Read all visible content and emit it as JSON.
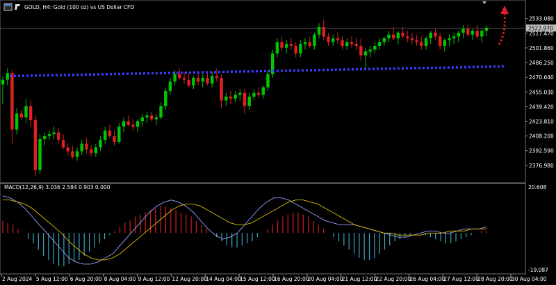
{
  "header": {
    "symbol_info": "GOLD, H4:  Gold (100 oz) vs US Dollar CFD",
    "icon": "window-icon"
  },
  "colors": {
    "background": "#000000",
    "bull": "#00c800",
    "bear": "#e02020",
    "support_line": "#3b3bff",
    "arrow": "#e0202a",
    "macd_hist_pos": "#d02020",
    "macd_hist_neg": "#3aa8c8",
    "macd_line": "#9aa0ff",
    "signal_line": "#e0c000",
    "grid": "#707070"
  },
  "price_axis": {
    "labels": [
      "2533.080",
      "2517.470",
      "2501.860",
      "2486.250",
      "2470.640",
      "2455.030",
      "2439.420",
      "2423.810",
      "2408.200",
      "2392.590",
      "2376.980"
    ],
    "current_price": "2522.970"
  },
  "macd_panel": {
    "label": "MACD(12,26,9) 3.036 2.584 0.903 0.000",
    "axis_top": "20.608",
    "axis_bottom": "-19.087"
  },
  "time_axis": {
    "labels": [
      "2 Aug 2024",
      "5 Aug 12:00",
      "6 Aug 20:00",
      "8 Aug 04:00",
      "9 Aug 12:00",
      "12 Aug 20:00",
      "14 Aug 04:00",
      "15 Aug 12:00",
      "16 Aug 20:00",
      "20 Aug 04:00",
      "21 Aug 12:00",
      "22 Aug 20:00",
      "26 Aug 04:00",
      "27 Aug 12:00",
      "28 Aug 20:00",
      "30 Aug 04:00"
    ]
  },
  "chart_data": {
    "type": "candlestick",
    "symbol": "GOLD",
    "timeframe": "H4",
    "y_range": [
      2368,
      2538
    ],
    "candles": [
      [
        2463,
        2472,
        2442,
        2468
      ],
      [
        2468,
        2480,
        2462,
        2475
      ],
      [
        2475,
        2478,
        2400,
        2415
      ],
      [
        2415,
        2438,
        2410,
        2432
      ],
      [
        2432,
        2436,
        2425,
        2428
      ],
      [
        2428,
        2448,
        2422,
        2440
      ],
      [
        2440,
        2446,
        2418,
        2425
      ],
      [
        2425,
        2430,
        2365,
        2372
      ],
      [
        2372,
        2410,
        2368,
        2405
      ],
      [
        2405,
        2412,
        2398,
        2408
      ],
      [
        2408,
        2414,
        2404,
        2410
      ],
      [
        2410,
        2418,
        2405,
        2412
      ],
      [
        2412,
        2416,
        2400,
        2404
      ],
      [
        2404,
        2410,
        2394,
        2396
      ],
      [
        2396,
        2400,
        2388,
        2392
      ],
      [
        2392,
        2398,
        2384,
        2386
      ],
      [
        2386,
        2396,
        2382,
        2392
      ],
      [
        2392,
        2404,
        2388,
        2400
      ],
      [
        2400,
        2406,
        2390,
        2394
      ],
      [
        2394,
        2398,
        2386,
        2390
      ],
      [
        2390,
        2400,
        2386,
        2396
      ],
      [
        2396,
        2408,
        2392,
        2404
      ],
      [
        2404,
        2418,
        2400,
        2414
      ],
      [
        2414,
        2420,
        2406,
        2408
      ],
      [
        2408,
        2414,
        2398,
        2402
      ],
      [
        2402,
        2422,
        2400,
        2418
      ],
      [
        2418,
        2428,
        2412,
        2424
      ],
      [
        2424,
        2430,
        2418,
        2420
      ],
      [
        2420,
        2426,
        2414,
        2418
      ],
      [
        2418,
        2426,
        2412,
        2424
      ],
      [
        2424,
        2432,
        2418,
        2428
      ],
      [
        2428,
        2434,
        2422,
        2430
      ],
      [
        2430,
        2434,
        2424,
        2426
      ],
      [
        2426,
        2432,
        2420,
        2428
      ],
      [
        2428,
        2444,
        2426,
        2440
      ],
      [
        2440,
        2460,
        2436,
        2456
      ],
      [
        2456,
        2470,
        2452,
        2466
      ],
      [
        2466,
        2478,
        2462,
        2474
      ],
      [
        2474,
        2480,
        2468,
        2470
      ],
      [
        2470,
        2476,
        2464,
        2468
      ],
      [
        2468,
        2474,
        2460,
        2462
      ],
      [
        2462,
        2472,
        2458,
        2470
      ],
      [
        2470,
        2476,
        2462,
        2466
      ],
      [
        2466,
        2474,
        2460,
        2470
      ],
      [
        2470,
        2476,
        2462,
        2464
      ],
      [
        2464,
        2476,
        2460,
        2472
      ],
      [
        2472,
        2480,
        2466,
        2470
      ],
      [
        2470,
        2474,
        2438,
        2446
      ],
      [
        2446,
        2454,
        2440,
        2450
      ],
      [
        2450,
        2456,
        2442,
        2448
      ],
      [
        2448,
        2456,
        2444,
        2452
      ],
      [
        2452,
        2458,
        2446,
        2454
      ],
      [
        2454,
        2458,
        2432,
        2440
      ],
      [
        2440,
        2454,
        2436,
        2450
      ],
      [
        2450,
        2458,
        2446,
        2454
      ],
      [
        2454,
        2460,
        2448,
        2452
      ],
      [
        2452,
        2462,
        2448,
        2460
      ],
      [
        2460,
        2478,
        2456,
        2474
      ],
      [
        2474,
        2500,
        2470,
        2496
      ],
      [
        2496,
        2512,
        2492,
        2508
      ],
      [
        2508,
        2514,
        2498,
        2502
      ],
      [
        2502,
        2510,
        2496,
        2506
      ],
      [
        2506,
        2512,
        2500,
        2504
      ],
      [
        2504,
        2508,
        2492,
        2496
      ],
      [
        2496,
        2510,
        2492,
        2506
      ],
      [
        2506,
        2512,
        2500,
        2508
      ],
      [
        2508,
        2514,
        2502,
        2504
      ],
      [
        2504,
        2518,
        2500,
        2516
      ],
      [
        2516,
        2528,
        2512,
        2524
      ],
      [
        2524,
        2532,
        2510,
        2514
      ],
      [
        2514,
        2518,
        2504,
        2508
      ],
      [
        2508,
        2516,
        2504,
        2512
      ],
      [
        2512,
        2518,
        2506,
        2510
      ],
      [
        2510,
        2514,
        2500,
        2504
      ],
      [
        2504,
        2512,
        2500,
        2508
      ],
      [
        2508,
        2514,
        2502,
        2506
      ],
      [
        2506,
        2512,
        2500,
        2504
      ],
      [
        2504,
        2512,
        2488,
        2494
      ],
      [
        2494,
        2502,
        2478,
        2498
      ],
      [
        2498,
        2504,
        2492,
        2500
      ],
      [
        2500,
        2508,
        2496,
        2504
      ],
      [
        2504,
        2512,
        2500,
        2508
      ],
      [
        2508,
        2514,
        2504,
        2512
      ],
      [
        2512,
        2520,
        2508,
        2516
      ],
      [
        2516,
        2524,
        2510,
        2512
      ],
      [
        2512,
        2520,
        2506,
        2518
      ],
      [
        2518,
        2524,
        2512,
        2514
      ],
      [
        2514,
        2520,
        2508,
        2512
      ],
      [
        2512,
        2518,
        2506,
        2510
      ],
      [
        2510,
        2516,
        2504,
        2508
      ],
      [
        2508,
        2514,
        2500,
        2504
      ],
      [
        2504,
        2514,
        2500,
        2512
      ],
      [
        2512,
        2520,
        2506,
        2518
      ],
      [
        2518,
        2522,
        2510,
        2514
      ],
      [
        2514,
        2518,
        2500,
        2504
      ],
      [
        2504,
        2512,
        2498,
        2510
      ],
      [
        2510,
        2516,
        2504,
        2512
      ],
      [
        2512,
        2518,
        2506,
        2514
      ],
      [
        2514,
        2520,
        2508,
        2518
      ],
      [
        2518,
        2526,
        2512,
        2522
      ],
      [
        2522,
        2526,
        2514,
        2516
      ],
      [
        2516,
        2522,
        2510,
        2520
      ],
      [
        2520,
        2526,
        2512,
        2514
      ],
      [
        2514,
        2522,
        2508,
        2520
      ],
      [
        2520,
        2526,
        2514,
        2523
      ]
    ],
    "support_level": 2480,
    "macd": {
      "y_range": [
        -19.087,
        20.608
      ],
      "histogram": [
        6,
        5,
        4,
        2,
        0,
        -3,
        -5,
        -8,
        -11,
        -13,
        -15,
        -16,
        -16,
        -15,
        -14,
        -13,
        -11,
        -9,
        -7,
        -5,
        -3,
        -1,
        1,
        3,
        5,
        6,
        8,
        9,
        10,
        11,
        12,
        13,
        13,
        12,
        11,
        10,
        9,
        8,
        6,
        4,
        2,
        0,
        -2,
        -4,
        -6,
        -7,
        -7,
        -6,
        -5,
        -4,
        -2,
        0,
        2,
        4,
        6,
        8,
        9,
        10,
        10,
        9,
        8,
        6,
        4,
        2,
        0,
        -2,
        -4,
        -6,
        -8,
        -10,
        -12,
        -13,
        -13,
        -12,
        -10,
        -8,
        -6,
        -4,
        -3,
        -2,
        -1,
        0,
        0,
        -1,
        -2,
        -3,
        -4,
        -5,
        -5,
        -4,
        -3,
        -2,
        -1,
        0,
        1,
        1
      ],
      "macd_line": [
        18,
        17,
        15,
        12,
        8,
        4,
        0,
        -4,
        -8,
        -12,
        -14,
        -15,
        -15,
        -14,
        -12,
        -10,
        -6,
        -2,
        2,
        6,
        10,
        13,
        15,
        16,
        15,
        13,
        10,
        6,
        2,
        -1,
        -3,
        -2,
        0,
        4,
        8,
        12,
        15,
        17,
        17,
        16,
        14,
        12,
        10,
        8,
        6,
        5,
        4,
        4,
        4,
        3,
        2,
        1,
        0,
        -1,
        -2,
        -2,
        -1,
        0,
        1,
        1,
        0,
        0,
        1,
        2,
        2,
        2,
        3
      ],
      "signal_line": [
        16,
        16,
        15,
        14,
        12,
        9,
        6,
        3,
        0,
        -4,
        -7,
        -10,
        -12,
        -13,
        -13,
        -12,
        -10,
        -7,
        -4,
        -1,
        2,
        5,
        8,
        11,
        13,
        14,
        14,
        13,
        11,
        9,
        7,
        5,
        4,
        4,
        5,
        7,
        9,
        11,
        13,
        15,
        16,
        16,
        15,
        14,
        12,
        10,
        8,
        6,
        4,
        3,
        2,
        1,
        0,
        0,
        -1,
        -1,
        -1,
        -1,
        0,
        0,
        0,
        1,
        1,
        1,
        2,
        2,
        2
      ]
    }
  }
}
